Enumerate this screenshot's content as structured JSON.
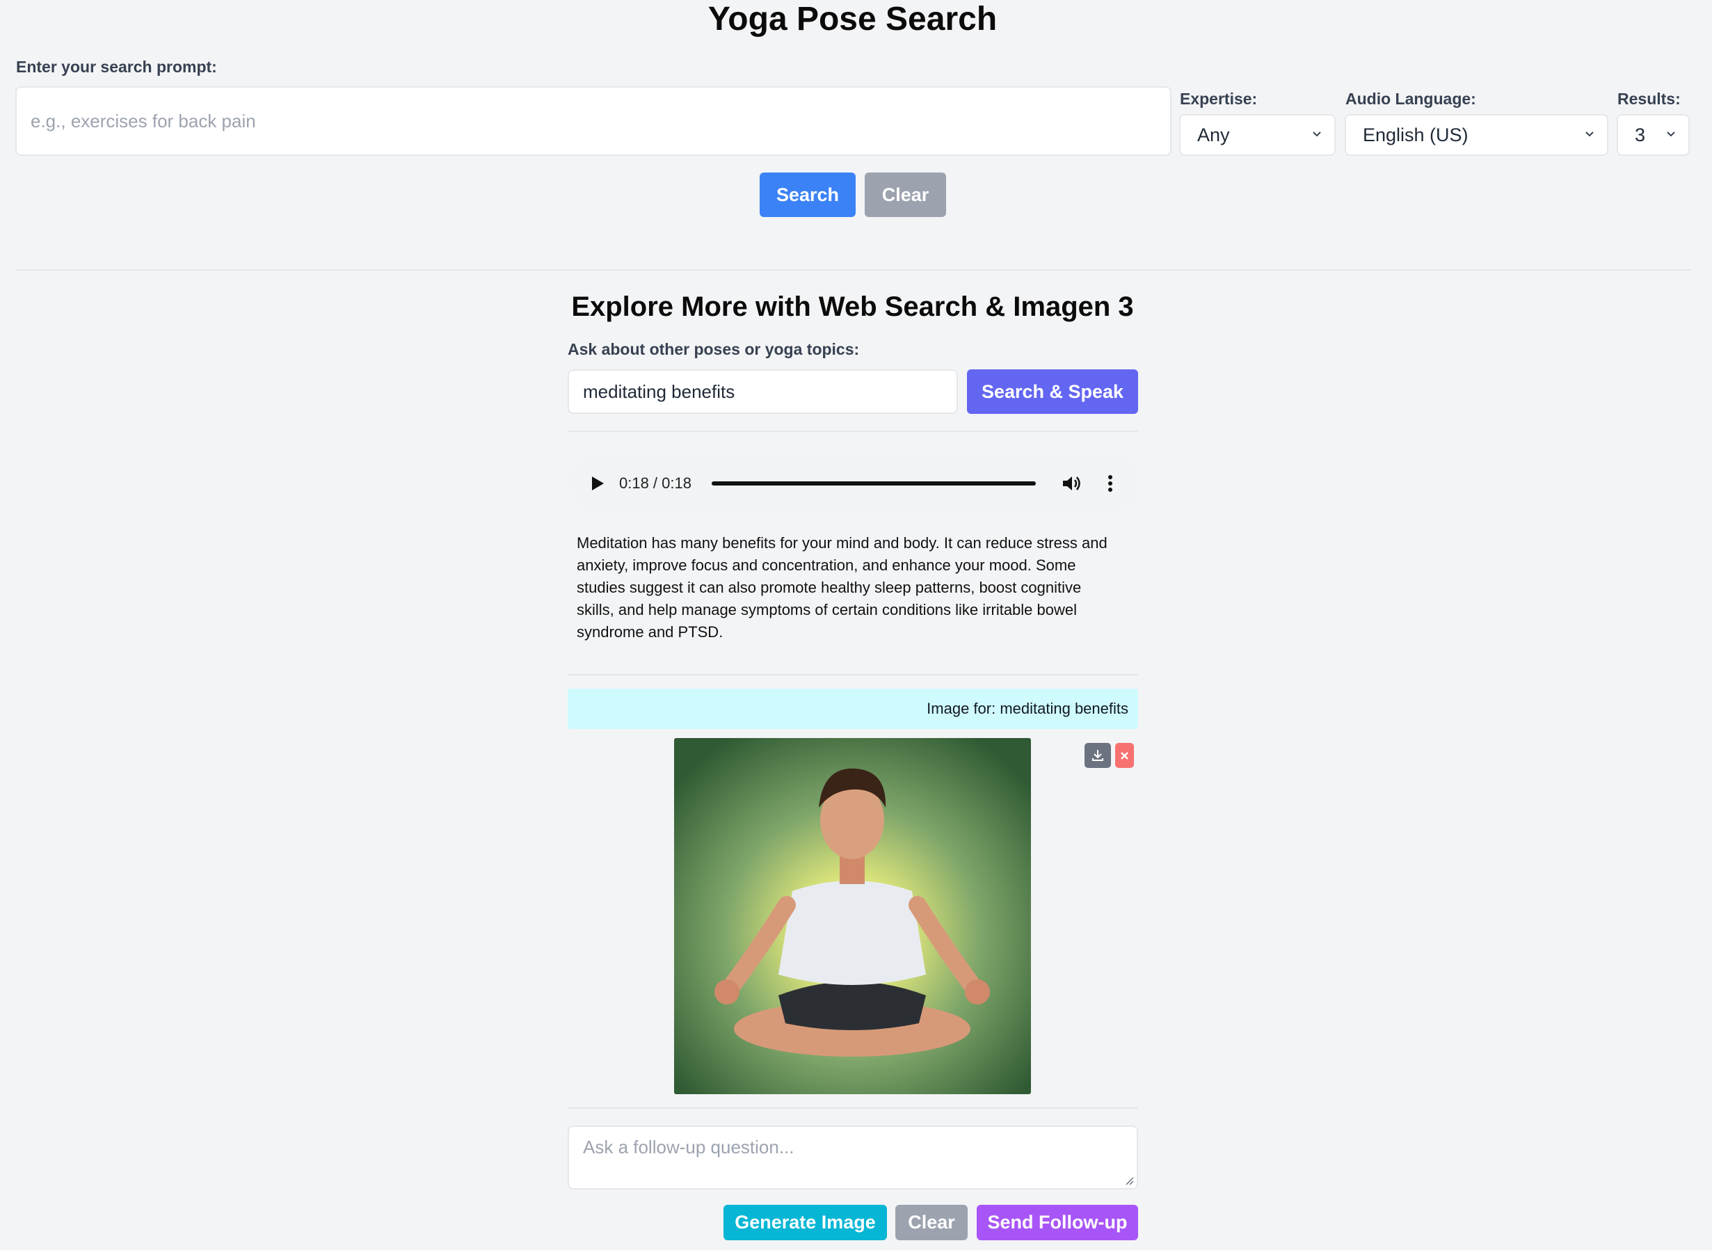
{
  "header": {
    "title": "Yoga Pose Search"
  },
  "search": {
    "label": "Enter your search prompt:",
    "placeholder": "e.g., exercises for back pain",
    "expertise_label": "Expertise:",
    "expertise_value": "Any",
    "audio_language_label": "Audio Language:",
    "audio_language_value": "English (US)",
    "results_label": "Results:",
    "results_value": "3",
    "search_button": "Search",
    "clear_button": "Clear"
  },
  "explore": {
    "title": "Explore More with Web Search & Imagen 3",
    "ask_label": "Ask about other poses or yoga topics:",
    "query_value": "meditating benefits",
    "search_speak_button": "Search & Speak",
    "audio": {
      "time": "0:18 / 0:18",
      "progress": 1.0
    },
    "answer": "Meditation has many benefits for your mind and body. It can reduce stress and anxiety, improve focus and concentration, and enhance your mood. Some studies suggest it can also promote healthy sleep patterns, boost cognitive skills, and help manage symptoms of certain conditions like irritable bowel syndrome and PTSD.",
    "image_caption": "Image for: meditating benefits",
    "followup_placeholder": "Ask a follow-up question...",
    "generate_button": "Generate Image",
    "clear_button": "Clear",
    "send_button": "Send Follow-up"
  },
  "colors": {
    "primary_blue": "#3b82f6",
    "gray_button": "#9ca3af",
    "indigo_button": "#6366f1",
    "cyan_button": "#06b6d4",
    "purple_button": "#a855f7",
    "caption_bg": "#cffafe",
    "delete_red": "#f87171",
    "download_gray": "#6b7280"
  },
  "icons": [
    "play-icon",
    "volume-icon",
    "more-vertical-icon",
    "download-icon",
    "close-icon",
    "chevron-down-icon",
    "resize-handle-icon"
  ]
}
